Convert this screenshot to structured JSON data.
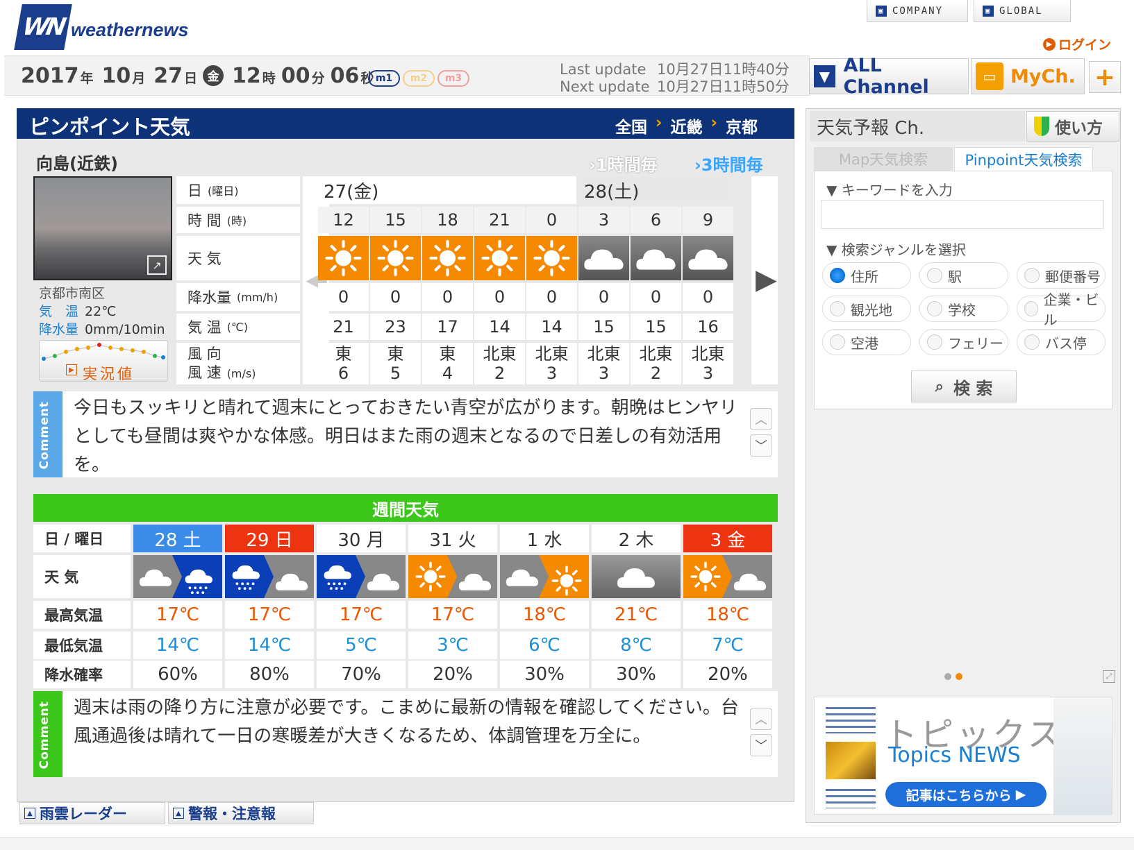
{
  "brand": {
    "logo_mark": "WN",
    "logo_text": "weathernews"
  },
  "top_links": {
    "company": "COMPANY",
    "global": "GLOBAL",
    "login": "ログイン"
  },
  "clock": {
    "year": "2017",
    "year_unit": "年",
    "month": "10",
    "month_unit": "月",
    "day": "27",
    "day_unit": "日",
    "weekday": "金",
    "hour": "12",
    "hour_unit": "時",
    "minute": "00",
    "minute_unit": "分",
    "second": "06",
    "second_unit": "秒"
  },
  "mode_pills": [
    "m1",
    "m2",
    "m3"
  ],
  "update": {
    "last_label": "Last update",
    "last_value": "10月27日11時40分",
    "next_label": "Next update",
    "next_value": "10月27日11時50分"
  },
  "channels": {
    "all": "ALL Channel",
    "my": "MyCh.",
    "add": "+"
  },
  "pinpoint": {
    "title": "ピンポイント天気",
    "breadcrumb": [
      "全国",
      "近畿",
      "京都"
    ],
    "location": "向島(近鉄)",
    "tab_1h": "1時間毎",
    "tab_3h": "3時間毎",
    "photo_area": "京都市南区",
    "obs_temp_label": "気　温",
    "obs_temp": "22℃",
    "obs_rain_label": "降水量",
    "obs_rain": "0mm/10min",
    "obs_button": "実況値",
    "row_labels": {
      "date": "日",
      "date_sub": "(曜日)",
      "time": "時 間",
      "time_sub": "(時)",
      "weather": "天 気",
      "rain": "降水量",
      "rain_sub": "(mm/h)",
      "temp": "気 温",
      "temp_sub": "(℃)",
      "wind_dir": "風 向",
      "wind_speed": "風 速",
      "wind_sub": "(m/s)"
    },
    "days": [
      {
        "label": "27(金)",
        "span": 5
      },
      {
        "label": "28(土)",
        "span": 3
      }
    ],
    "hours": [
      {
        "time": "12",
        "weather": "sunny",
        "rain": "0",
        "temp": "21",
        "wind_dir": "東",
        "wind_speed": "6"
      },
      {
        "time": "15",
        "weather": "sunny",
        "rain": "0",
        "temp": "23",
        "wind_dir": "東",
        "wind_speed": "5"
      },
      {
        "time": "18",
        "weather": "sunny",
        "rain": "0",
        "temp": "17",
        "wind_dir": "東",
        "wind_speed": "4"
      },
      {
        "time": "21",
        "weather": "sunny",
        "rain": "0",
        "temp": "14",
        "wind_dir": "北東",
        "wind_speed": "2"
      },
      {
        "time": "0",
        "weather": "sunny",
        "rain": "0",
        "temp": "14",
        "wind_dir": "北東",
        "wind_speed": "3"
      },
      {
        "time": "3",
        "weather": "cloudy",
        "rain": "0",
        "temp": "15",
        "wind_dir": "北東",
        "wind_speed": "3"
      },
      {
        "time": "6",
        "weather": "cloudy",
        "rain": "0",
        "temp": "15",
        "wind_dir": "北東",
        "wind_speed": "2"
      },
      {
        "time": "9",
        "weather": "cloudy",
        "rain": "0",
        "temp": "16",
        "wind_dir": "北東",
        "wind_speed": "3"
      }
    ],
    "comment_tag": "Comment",
    "comment": "今日もスッキリと晴れて週末にとっておきたい青空が広がります。朝晩はヒンヤリとしても昼間は爽やかな体感。明日はまた雨の週末となるので日差しの有効活用を。"
  },
  "weekly": {
    "title": "週間天気",
    "labels": {
      "day": "日 / 曜日",
      "weather": "天 気",
      "high": "最高気温",
      "low": "最低気温",
      "pop": "降水確率"
    },
    "days": [
      {
        "day": "28 土",
        "type": "sat",
        "icon": "cloud-to-rain",
        "high": "17℃",
        "low": "14℃",
        "pop": "60%"
      },
      {
        "day": "29 日",
        "type": "sun",
        "icon": "rain-to-cloud",
        "high": "17℃",
        "low": "14℃",
        "pop": "80%"
      },
      {
        "day": "30 月",
        "type": "weekday",
        "icon": "rain-to-cloud",
        "high": "17℃",
        "low": "5℃",
        "pop": "70%"
      },
      {
        "day": "31 火",
        "type": "weekday",
        "icon": "sun-to-cloud",
        "high": "17℃",
        "low": "3℃",
        "pop": "20%"
      },
      {
        "day": "1 水",
        "type": "weekday",
        "icon": "cloud-to-sun",
        "high": "18℃",
        "low": "6℃",
        "pop": "30%"
      },
      {
        "day": "2 木",
        "type": "weekday",
        "icon": "cloud",
        "high": "21℃",
        "low": "8℃",
        "pop": "30%"
      },
      {
        "day": "3 金",
        "type": "holiday",
        "icon": "sun-to-cloud",
        "high": "18℃",
        "low": "7℃",
        "pop": "20%"
      }
    ],
    "comment_tag": "Comment",
    "comment": "週末は雨の降り方に注意が必要です。こまめに最新の情報を確認してください。台風通過後は晴れて一日の寒暖差が大きくなるため、体調管理を万全に。"
  },
  "bottom_tabs": [
    "雨雲レーダー",
    "警報・注意報"
  ],
  "side": {
    "title": "天気予報 Ch.",
    "usage": "使い方",
    "tab_map": "Map天気検索",
    "tab_pinpoint": "Pinpoint天気検索",
    "keyword_label": "▼ キーワードを入力",
    "keyword_value": "",
    "genre_label": "▼ 検索ジャンルを選択",
    "genres": [
      "住所",
      "駅",
      "郵便番号",
      "観光地",
      "学校",
      "企業・ビル",
      "空港",
      "フェリー",
      "バス停"
    ],
    "selected_genre": "住所",
    "search_button": "検 索",
    "topics_title": "トピックス",
    "topics_sub": "Topics NEWS",
    "topics_button": "記事はこちらから"
  },
  "colors": {
    "navy": "#0e3278",
    "orange": "#f58a00",
    "green": "#3cc81a",
    "saturday": "#3b8ce8",
    "sunday": "#ee3311",
    "high": "#ee5500",
    "low": "#1a8fd6",
    "link_blue": "#1a7fd0"
  }
}
